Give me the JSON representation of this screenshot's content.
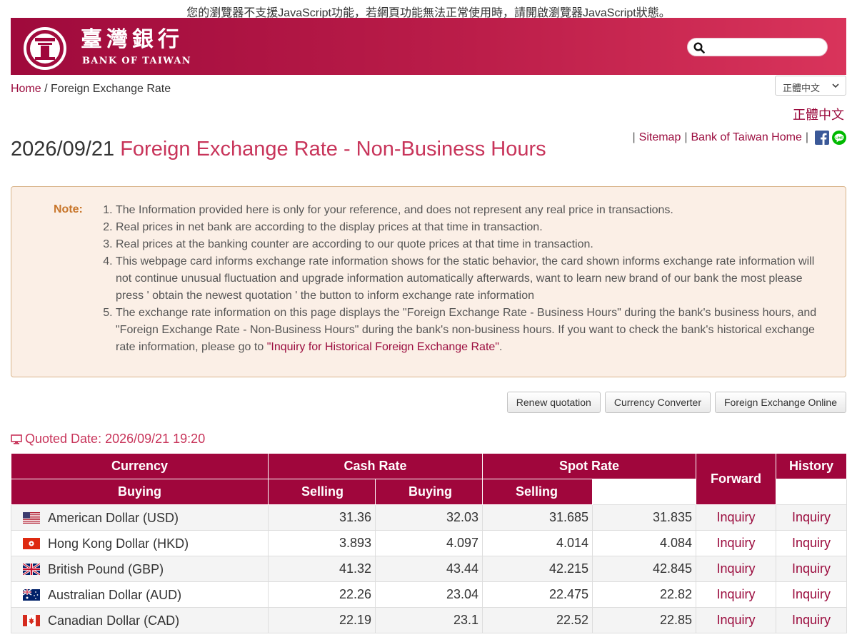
{
  "notice": "您的瀏覽器不支援JavaScript功能，若網頁功能無法正常使用時，請開啟瀏覽器JavaScript狀態。",
  "header": {
    "logo_zh": "臺灣銀行",
    "logo_en": "BANK OF TAIWAN",
    "search": {
      "value": ""
    }
  },
  "breadcrumb": {
    "home": "Home",
    "separator": " / ",
    "current": "Foreign Exchange Rate"
  },
  "language": {
    "selected": "正體中文",
    "link": "正體中文"
  },
  "toplinks": {
    "sitemap": "Sitemap",
    "home": "Bank of Taiwan Home"
  },
  "title": {
    "date": "2026/09/21",
    "text": "Foreign Exchange Rate - Non-Business Hours"
  },
  "note": {
    "label": "Note:",
    "items": [
      "The Information provided here is only for your reference, and does not represent any real price in transactions.",
      "Real prices in net bank are according to the display prices at that time in transaction.",
      "Real prices at the banking counter are according to our quote prices at that time in transaction.",
      "This webpage card informs exchange rate information shows for the static behavior, the card shown informs exchange rate information will not continue unusual fluctuation and upgrade information automatically afterwards, want to learn new brand of our bank the most please press ' obtain the newest quotation ' the button to inform exchange rate information"
    ],
    "item5_before": "The exchange rate information on this page displays the \"Foreign Exchange Rate - Business Hours\" during the bank's business hours, and \"Foreign Exchange Rate - Non-Business Hours\" during the bank's non-business hours. If you want to check the bank's historical exchange rate information, please go to ",
    "item5_link": "\"Inquiry for Historical Foreign Exchange Rate\"",
    "item5_after": "."
  },
  "buttons": {
    "renew": "Renew quotation",
    "converter": "Currency Converter",
    "online": "Foreign Exchange Online"
  },
  "quoted": "Quoted Date: 2026/09/21 19:20",
  "table": {
    "headers": {
      "currency": "Currency",
      "cash_rate": "Cash Rate",
      "spot_rate": "Spot Rate",
      "forward": "Forward",
      "history": "History",
      "buying": "Buying",
      "selling": "Selling"
    },
    "rows": [
      {
        "name": "American Dollar (USD)",
        "flag": "us",
        "cash_buy": "31.36",
        "cash_sell": "32.03",
        "spot_buy": "31.685",
        "spot_sell": "31.835",
        "forward": "Inquiry",
        "history": "Inquiry"
      },
      {
        "name": "Hong Kong Dollar (HKD)",
        "flag": "hk",
        "cash_buy": "3.893",
        "cash_sell": "4.097",
        "spot_buy": "4.014",
        "spot_sell": "4.084",
        "forward": "Inquiry",
        "history": "Inquiry"
      },
      {
        "name": "British Pound (GBP)",
        "flag": "gb",
        "cash_buy": "41.32",
        "cash_sell": "43.44",
        "spot_buy": "42.215",
        "spot_sell": "42.845",
        "forward": "Inquiry",
        "history": "Inquiry"
      },
      {
        "name": "Australian Dollar (AUD)",
        "flag": "au",
        "cash_buy": "22.26",
        "cash_sell": "23.04",
        "spot_buy": "22.475",
        "spot_sell": "22.82",
        "forward": "Inquiry",
        "history": "Inquiry"
      },
      {
        "name": "Canadian Dollar (CAD)",
        "flag": "ca",
        "cash_buy": "22.19",
        "cash_sell": "23.1",
        "spot_buy": "22.52",
        "spot_sell": "22.85",
        "forward": "Inquiry",
        "history": "Inquiry"
      }
    ]
  },
  "colors": {
    "brand": "#a0063c",
    "link": "#9b0c3e",
    "title_accent": "#c8345a",
    "note_bg": "#fbefe6",
    "note_label": "#c8762b"
  }
}
